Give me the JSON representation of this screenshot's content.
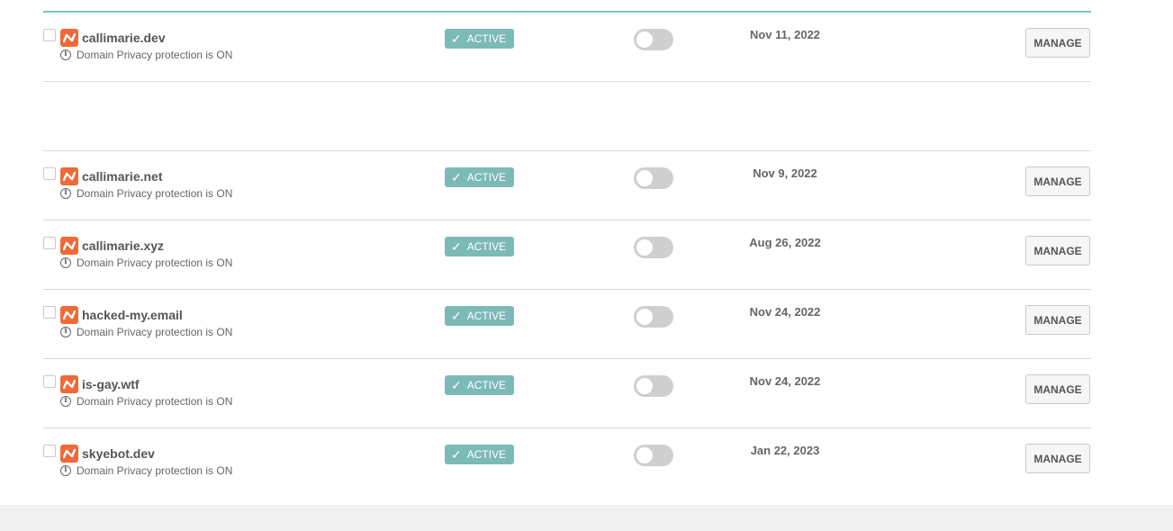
{
  "domains": [
    {
      "name": "callimarie.dev",
      "privacy": "Domain Privacy protection is ON",
      "status": "ACTIVE",
      "date": "Nov 11, 2022",
      "manage": "MANAGE"
    },
    {
      "name": "callimarie.net",
      "privacy": "Domain Privacy protection is ON",
      "status": "ACTIVE",
      "date": "Nov 9, 2022",
      "manage": "MANAGE"
    },
    {
      "name": "callimarie.xyz",
      "privacy": "Domain Privacy protection is ON",
      "status": "ACTIVE",
      "date": "Aug 26, 2022",
      "manage": "MANAGE"
    },
    {
      "name": "hacked-my.email",
      "privacy": "Domain Privacy protection is ON",
      "status": "ACTIVE",
      "date": "Nov 24, 2022",
      "manage": "MANAGE"
    },
    {
      "name": "is-gay.wtf",
      "privacy": "Domain Privacy protection is ON",
      "status": "ACTIVE",
      "date": "Nov 24, 2022",
      "manage": "MANAGE"
    },
    {
      "name": "skyebot.dev",
      "privacy": "Domain Privacy protection is ON",
      "status": "ACTIVE",
      "date": "Jan 22, 2023",
      "manage": "MANAGE"
    }
  ],
  "colors": {
    "accent_teal": "#7cbab8",
    "brand_orange": "#ef6a38",
    "toggle_off": "#cfcfcf"
  },
  "icons": {
    "brand": "namecheap-logo-icon",
    "info": "info-icon",
    "status": "check-icon"
  },
  "toggle_states": [
    false,
    false,
    false,
    false,
    false,
    false
  ]
}
